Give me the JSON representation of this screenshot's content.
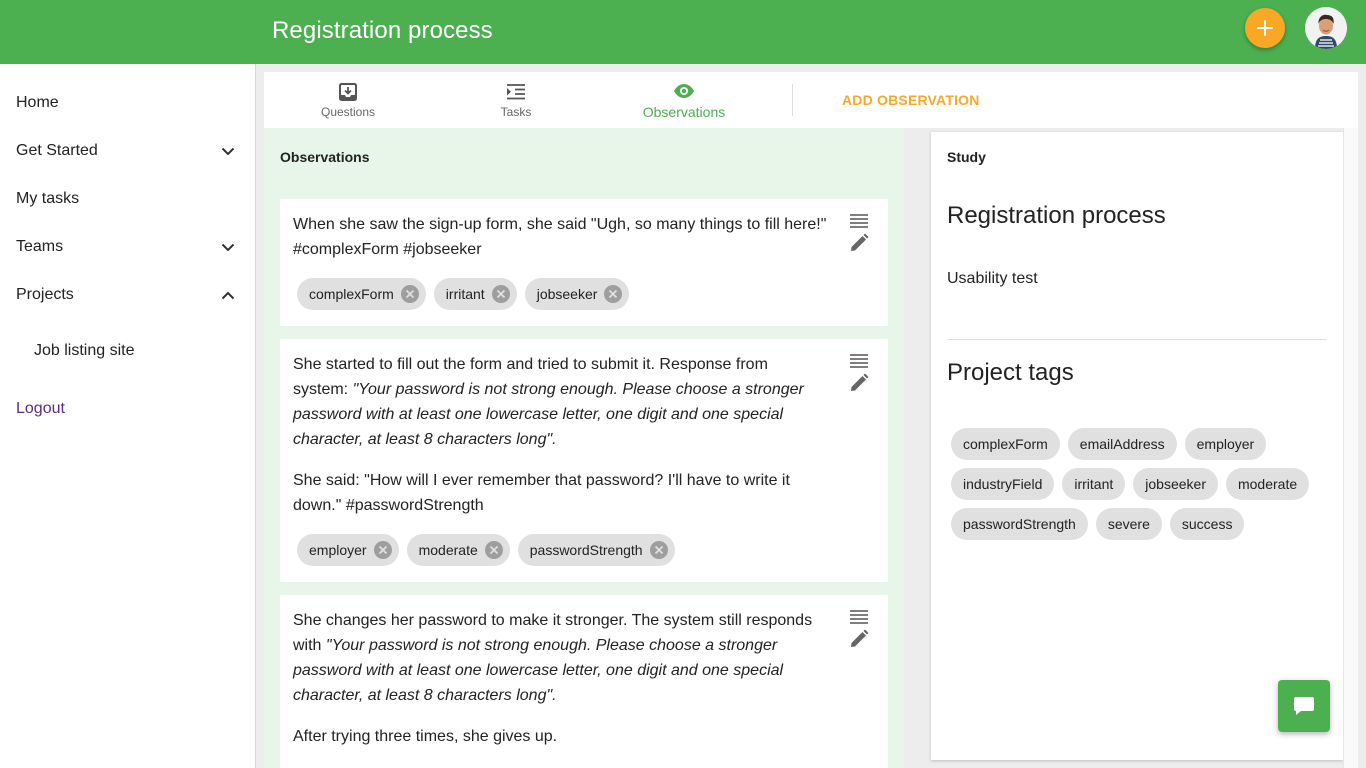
{
  "header": {
    "title": "Registration process",
    "add_icon": "plus-icon",
    "avatar_icon": "user-avatar"
  },
  "sidebar": {
    "items": [
      {
        "label": "Home"
      },
      {
        "label": "Get Started",
        "icon": "chevron-down-icon"
      },
      {
        "label": "My tasks"
      },
      {
        "label": "Teams",
        "icon": "chevron-down-icon"
      },
      {
        "label": "Projects",
        "icon": "chevron-up-icon"
      },
      {
        "label": "Job listing site"
      },
      {
        "label": "Logout"
      }
    ]
  },
  "tabs": [
    {
      "label": "Questions",
      "icon": "inbox-download-icon"
    },
    {
      "label": "Tasks",
      "icon": "list-indent-icon"
    },
    {
      "label": "Observations",
      "icon": "eye-icon",
      "active": true
    }
  ],
  "add_observation_label": "ADD OBSERVATION",
  "observations": {
    "title": "Observations",
    "cards": [
      {
        "paragraphs": [
          {
            "text": "When she saw the sign-up form, she said \"Ugh, so many things to fill here!\" #complexForm #jobseeker"
          }
        ],
        "tags": [
          "complexForm",
          "irritant",
          "jobseeker"
        ]
      },
      {
        "paragraphs": [
          {
            "prefix": "She started to fill out the form and tried to submit it. Response from system: ",
            "quote": "\"Your password is not strong enough. Please choose a stronger password with at least one lowercase letter, one digit and one special character, at least 8 characters long\".",
            "suffix": ""
          },
          {
            "text": "She said: \"How will I ever remember that password? I'll have to write it down.\" #passwordStrength"
          }
        ],
        "tags": [
          "employer",
          "moderate",
          "passwordStrength"
        ]
      },
      {
        "paragraphs": [
          {
            "prefix": "She changes her password to make it stronger. The system still responds with ",
            "quote": "\"Your password is not strong enough. Please choose a stronger password with at least one lowercase letter, one digit and one special character, at least 8 characters long\".",
            "suffix": ""
          },
          {
            "text": "After trying three times, she gives up."
          }
        ],
        "tags": []
      }
    ]
  },
  "study": {
    "label": "Study",
    "title": "Registration process",
    "type": "Usability test",
    "tags_title": "Project tags",
    "project_tags": [
      "complexForm",
      "emailAddress",
      "employer",
      "industryField",
      "irritant",
      "jobseeker",
      "moderate",
      "passwordStrength",
      "severe",
      "success"
    ]
  },
  "colors": {
    "primary": "#4caf50",
    "accent": "#f9a825",
    "observation_bg": "#e8f5e9",
    "logout": "#5b2d82"
  },
  "chat_icon": "chat-bubble-icon"
}
